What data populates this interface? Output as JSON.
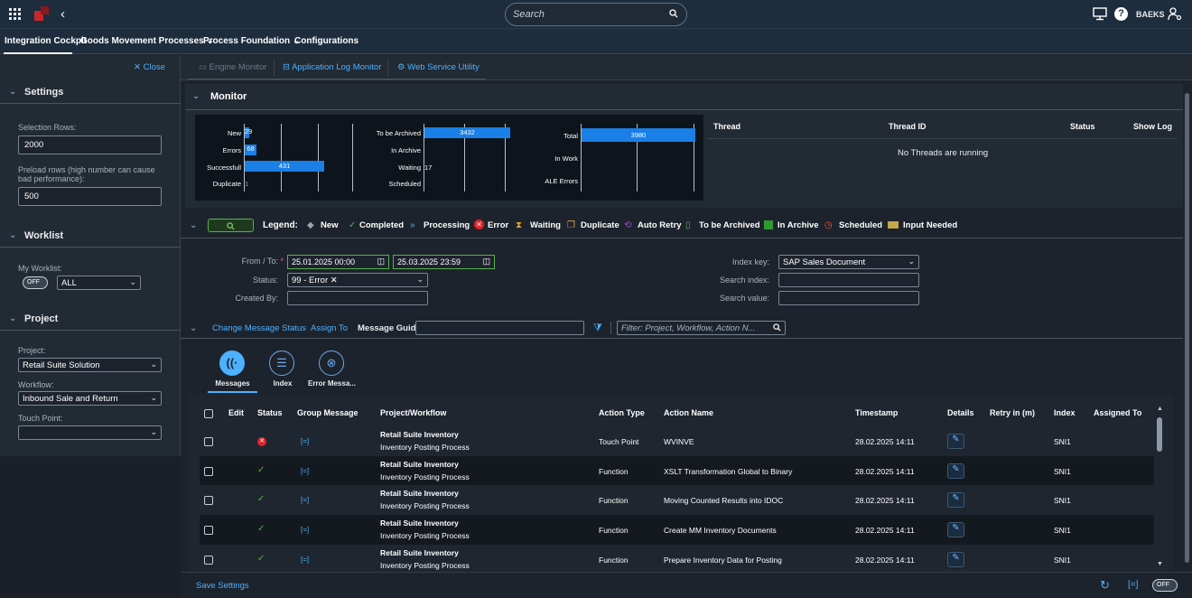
{
  "shell": {
    "search_placeholder": "Search",
    "user": "BAEKS"
  },
  "tabs": [
    "Integration Cockpit",
    "Goods Movement Processes",
    "Process Foundation",
    "Configurations"
  ],
  "sidebar": {
    "close": "Close",
    "settings": "Settings",
    "selection_rows_label": "Selection Rows:",
    "selection_rows": "2000",
    "preload_label": "Preload rows (high number can cause bad performance):",
    "preload": "500",
    "worklist": "Worklist",
    "my_worklist_label": "My Worklist:",
    "toggle": "OFF",
    "worklist_value": "ALL",
    "project": "Project",
    "project_label": "Project:",
    "project_value": "Retail Suite Solution",
    "workflow_label": "Workflow:",
    "workflow_value": "Inbound Sale and Return",
    "touch_point_label": "Touch Point:",
    "touch_point_value": ""
  },
  "toolbar": [
    "Engine Monitor",
    "Application Log Monitor",
    "Web Service Utility"
  ],
  "monitor": {
    "title": "Monitor",
    "group1": [
      {
        "label": "New",
        "value": 29
      },
      {
        "label": "Errors",
        "value": 68
      },
      {
        "label": "Successfull",
        "value": 431
      },
      {
        "label": "Duplicate",
        "value": 1
      }
    ],
    "group2": [
      {
        "label": "To be Archived",
        "value": 3432
      },
      {
        "label": "In Archive",
        "value": null
      },
      {
        "label": "Waiting",
        "value": 17
      },
      {
        "label": "Scheduled",
        "value": null
      }
    ],
    "group3": [
      {
        "label": "Total",
        "value": 3980
      },
      {
        "label": "In Work",
        "value": null
      },
      {
        "label": "ALE Errors",
        "value": null
      }
    ],
    "threads_cols": [
      "Thread",
      "Thread ID",
      "Status",
      "Show Log"
    ],
    "no_threads": "No Threads are running"
  },
  "legend": {
    "title": "Legend:",
    "items": [
      "New",
      "Completed",
      "Processing",
      "Error",
      "Waiting",
      "Duplicate",
      "Auto Retry",
      "To be Archived",
      "In Archive",
      "Scheduled",
      "Input Needed"
    ]
  },
  "filters": {
    "from_to_label": "From / To:",
    "from": "25.01.2025 00:00",
    "to": "25.03.2025 23:59",
    "status_label": "Status:",
    "status_token": "99 - Error",
    "created_by_label": "Created By:",
    "index_key_label": "Index key:",
    "index_key": "SAP Sales Document",
    "search_index_label": "Search index:",
    "search_value_label": "Search value:"
  },
  "actions": {
    "change_status": "Change Message Status",
    "assign_to": "Assign To",
    "message_guid": "Message Guid",
    "filter_placeholder": "Filter: Project, Workflow, Action N..."
  },
  "view_tabs": [
    "Messages",
    "Index",
    "Error Messa..."
  ],
  "table": {
    "columns": [
      "Edit",
      "Status",
      "Group Message",
      "Project/Workflow",
      "Action Type",
      "Action Name",
      "Timestamp",
      "Details",
      "Retry in (m)",
      "Index",
      "Assigned To"
    ],
    "rows": [
      {
        "status": "error",
        "project": "Retail Suite Inventory",
        "workflow": "Inventory Posting Process",
        "action_type": "Touch Point",
        "action_name": "WVINVE",
        "timestamp": "28.02.2025 14:11",
        "index": "SNI1"
      },
      {
        "status": "ok",
        "project": "Retail Suite Inventory",
        "workflow": "Inventory Posting Process",
        "action_type": "Function",
        "action_name": "XSLT Transformation Global to Binary",
        "timestamp": "28.02.2025 14:11",
        "index": "SNI1"
      },
      {
        "status": "ok",
        "project": "Retail Suite Inventory",
        "workflow": "Inventory Posting Process",
        "action_type": "Function",
        "action_name": "Moving Counted Results into IDOC",
        "timestamp": "28.02.2025 14:11",
        "index": "SNI1"
      },
      {
        "status": "ok",
        "project": "Retail Suite Inventory",
        "workflow": "Inventory Posting Process",
        "action_type": "Function",
        "action_name": "Create MM Inventory Documents",
        "timestamp": "28.02.2025 14:11",
        "index": "SNI1"
      },
      {
        "status": "ok",
        "project": "Retail Suite Inventory",
        "workflow": "Inventory Posting Process",
        "action_type": "Function",
        "action_name": "Prepare Inventory Data for Posting",
        "timestamp": "28.02.2025 14:11",
        "index": "SNI1"
      }
    ]
  },
  "footer": {
    "save": "Save Settings",
    "toggle": "OFF"
  }
}
